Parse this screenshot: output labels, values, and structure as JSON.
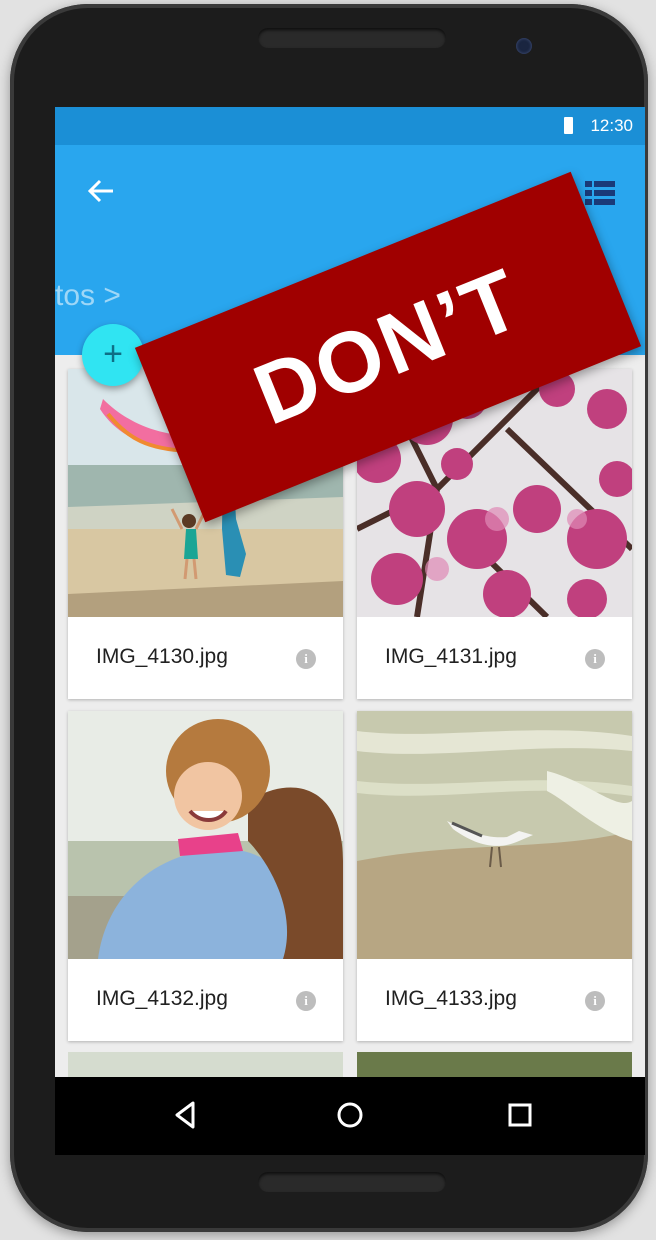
{
  "status_bar": {
    "time": "12:30"
  },
  "app_bar": {
    "breadcrumb": "tos >"
  },
  "fab": {
    "label": "+"
  },
  "files": [
    {
      "name": "IMG_4130.jpg"
    },
    {
      "name": "IMG_4131.jpg"
    },
    {
      "name": "IMG_4132.jpg"
    },
    {
      "name": "IMG_4133.jpg"
    }
  ],
  "banner": {
    "text": "DON’T",
    "color": "#a00000"
  },
  "colors": {
    "app_bar": "#29a6ee",
    "status_bar": "#1b8fd6",
    "fab": "#30e4f2"
  },
  "icons": {
    "back": "arrow-left-icon",
    "view": "list-view-icon",
    "info": "info-icon",
    "nav": [
      "back-triangle-icon",
      "home-circle-icon",
      "recents-square-icon"
    ]
  }
}
